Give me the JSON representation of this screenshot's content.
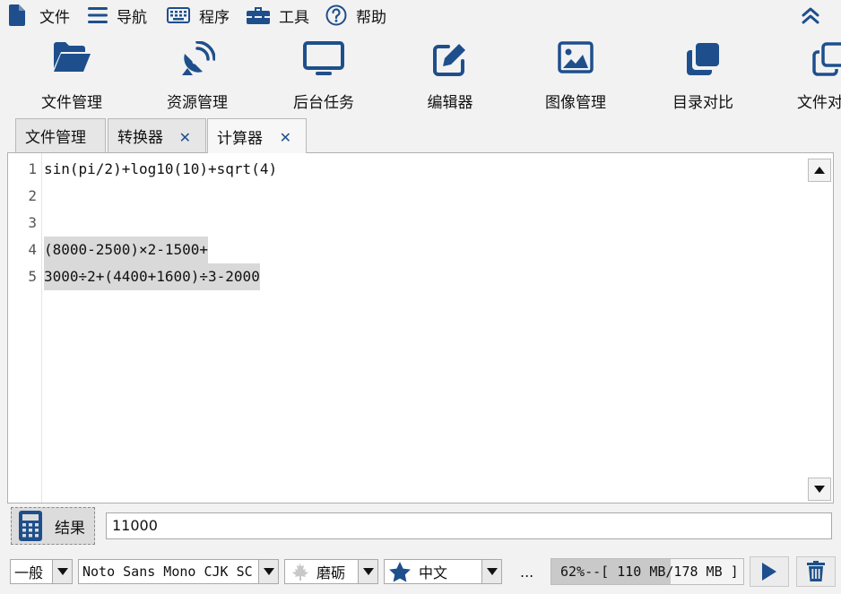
{
  "menu": {
    "file": "文件",
    "navigate": "导航",
    "program": "程序",
    "tools": "工具",
    "help": "帮助"
  },
  "toolbar": {
    "items": [
      {
        "label": "文件管理",
        "icon": "folder-open-icon"
      },
      {
        "label": "资源管理",
        "icon": "satellite-dish-icon"
      },
      {
        "label": "后台任务",
        "icon": "monitor-icon"
      },
      {
        "label": "编辑器",
        "icon": "edit-icon"
      },
      {
        "label": "图像管理",
        "icon": "image-icon"
      },
      {
        "label": "目录对比",
        "icon": "clone-icon"
      },
      {
        "label": "文件对",
        "icon": "copy-icon"
      }
    ]
  },
  "tabs": [
    {
      "label": "文件管理",
      "closable": false,
      "active": false
    },
    {
      "label": "转换器",
      "closable": true,
      "active": false
    },
    {
      "label": "计算器",
      "closable": true,
      "active": true
    }
  ],
  "editor": {
    "lines": [
      {
        "num": "1",
        "text": "sin(pi/2)+log10(10)+sqrt(4)",
        "selected": false
      },
      {
        "num": "2",
        "text": "",
        "selected": false
      },
      {
        "num": "3",
        "text": "",
        "selected": false
      },
      {
        "num": "4",
        "text": "(8000-2500)×2-1500+",
        "selected": true
      },
      {
        "num": "5",
        "text": "3000÷2+(4400+1600)÷3-2000",
        "selected": true
      }
    ]
  },
  "result": {
    "label": "结果",
    "value": "11000"
  },
  "status": {
    "category": "一般",
    "font": "Noto Sans Mono CJK SC",
    "theme": "磨砺",
    "language": "中文",
    "ellipsis": "...",
    "memory_text": "62%--[ 110 MB/178 MB ]",
    "memory_percent": 62
  },
  "colors": {
    "accent": "#1e4f8c",
    "selection": "#d9d9d9"
  }
}
